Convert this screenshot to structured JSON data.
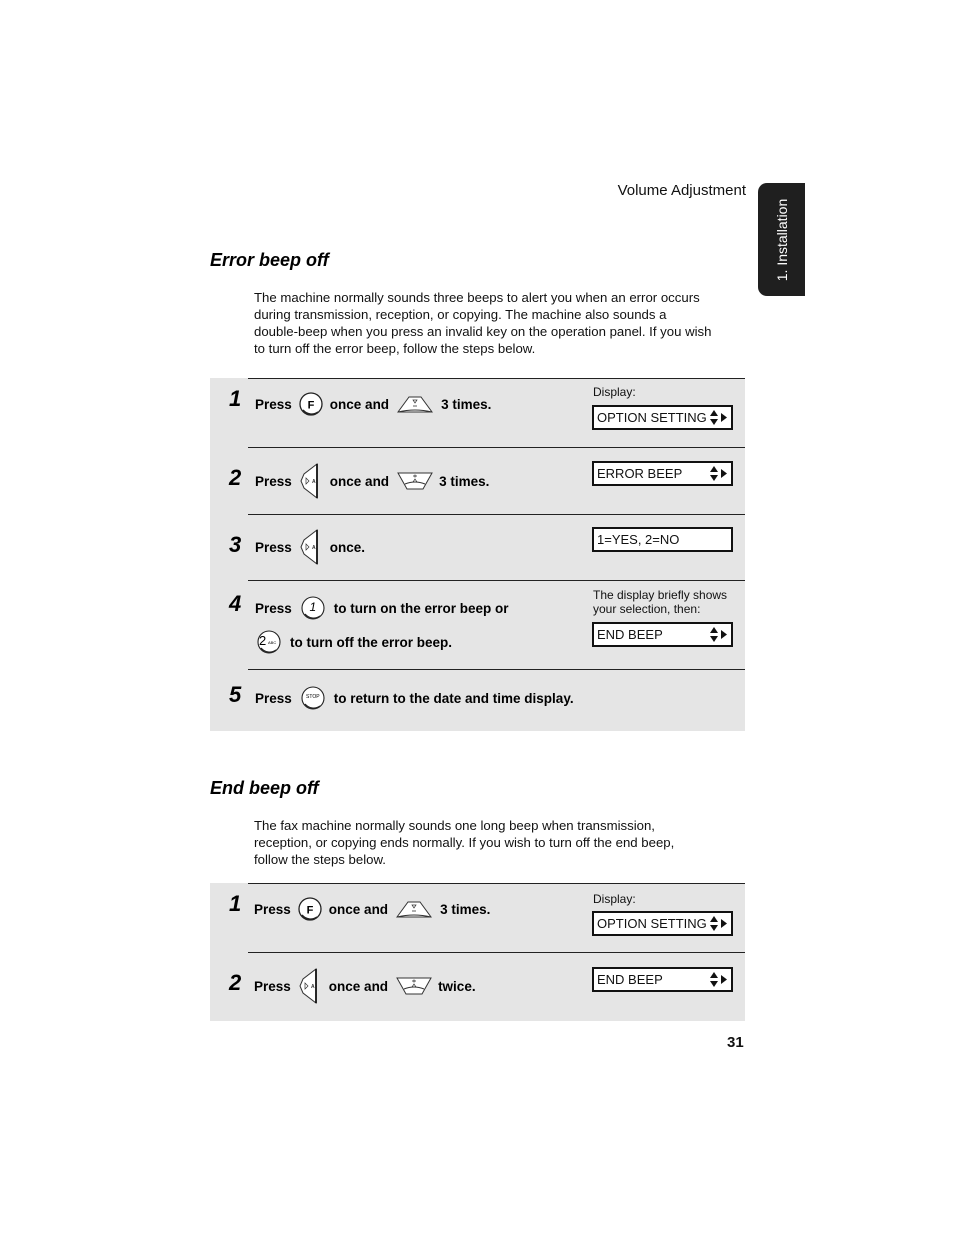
{
  "header": {
    "title": "Volume Adjustment",
    "side_tab": "1. Installation"
  },
  "sections": [
    {
      "title": "Error beep off",
      "intro_lines": [
        "The machine normally sounds three beeps to alert you when an error occurs",
        "during transmission, reception, or copying. The machine also sounds a",
        "double-beep when you press an invalid key on the operation panel. If you wish",
        "to turn off the error beep, follow the steps below."
      ],
      "steps": [
        {
          "number": "1",
          "press": "Press",
          "mid": "once and",
          "end": "3 times.",
          "display_label": "Display:",
          "lcd": "OPTION SETTING",
          "icon1": "function-key-icon",
          "icon2": "volume-down-key-icon"
        },
        {
          "number": "2",
          "press": "Press",
          "mid": "once and",
          "end": "3 times.",
          "lcd": "ERROR BEEP",
          "icon1": "set-key-icon",
          "icon2": "volume-up-key-icon"
        },
        {
          "number": "3",
          "press": "Press",
          "end": "once.",
          "lcd": "1=YES, 2=NO",
          "icon1": "set-key-icon"
        },
        {
          "number": "4",
          "press": "Press",
          "mid": "to turn on the error beep or",
          "line2": "to turn off the error beep.",
          "display_label_1": "The display briefly shows",
          "display_label_2": "your selection, then:",
          "lcd": "END BEEP",
          "icon1": "key-1-icon",
          "icon2": "key-2-abc-icon",
          "key1_text": "1",
          "key2_text": "2",
          "key2_sub": "ABC"
        },
        {
          "number": "5",
          "press": "Press",
          "end": "to return to the date and time display.",
          "icon1": "stop-key-icon",
          "key_text": "STOP"
        }
      ]
    },
    {
      "title": "End beep off",
      "intro_lines": [
        "The fax machine normally sounds one long beep when transmission,",
        "reception, or copying ends normally. If you wish to turn off the end beep,",
        "follow the steps below."
      ],
      "steps": [
        {
          "number": "1",
          "press": "Press",
          "mid": "once and",
          "end": "3 times.",
          "display_label": "Display:",
          "lcd": "OPTION SETTING",
          "icon1": "function-key-icon",
          "icon2": "volume-down-key-icon"
        },
        {
          "number": "2",
          "press": "Press",
          "mid": "once and",
          "end": "twice.",
          "lcd": "END BEEP",
          "icon1": "set-key-icon",
          "icon2": "volume-up-key-icon"
        }
      ]
    }
  ],
  "keys": {
    "function_letter": "F"
  },
  "page_number": "31"
}
